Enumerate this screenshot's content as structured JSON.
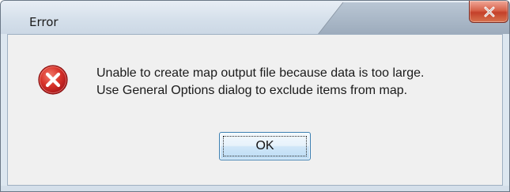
{
  "window": {
    "title": "Error",
    "close_icon": "close-icon"
  },
  "dialog": {
    "icon": "error-icon",
    "message_lines": [
      "Unable to create map output file because data is too large.",
      "Use General Options dialog to exclude items from map."
    ],
    "ok_label": "OK"
  },
  "colors": {
    "error_red": "#c8271f",
    "close_button": "#c4402a",
    "button_border": "#3c7fb1"
  }
}
